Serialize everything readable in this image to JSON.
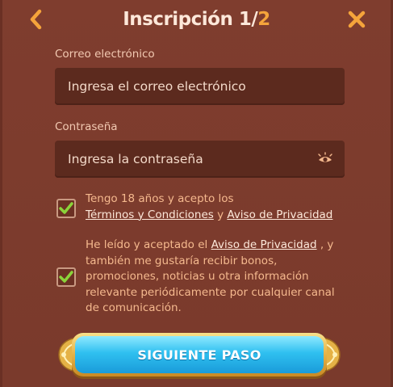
{
  "header": {
    "title": "Inscripción 1/",
    "title_num": "2"
  },
  "email": {
    "label": "Correo electrónico",
    "placeholder": "Ingresa el correo electrónico"
  },
  "password": {
    "label": "Contraseña",
    "placeholder": "Ingresa la contraseña"
  },
  "consent1": {
    "text_a": "Tengo 18 años y acepto los",
    "link1": "Términos y Condiciones",
    "text_b": " y ",
    "link2": "Aviso de Privacidad",
    "checked": true
  },
  "consent2": {
    "text_a": "He leído y aceptado el ",
    "link1": "Aviso de Privacidad",
    "text_b": " , y también me gustaría recibir bonos, promociones, noticias u otra información relevante periódicamente por cualquier canal de comunicación.",
    "checked": true
  },
  "cta": {
    "label": "SIGUIENTE PASO"
  },
  "colors": {
    "background": "#7a3a2c",
    "accent": "#f5a43b",
    "check": "#8bd33a",
    "button": "#2fc0f0",
    "gold": "#e5b246"
  }
}
